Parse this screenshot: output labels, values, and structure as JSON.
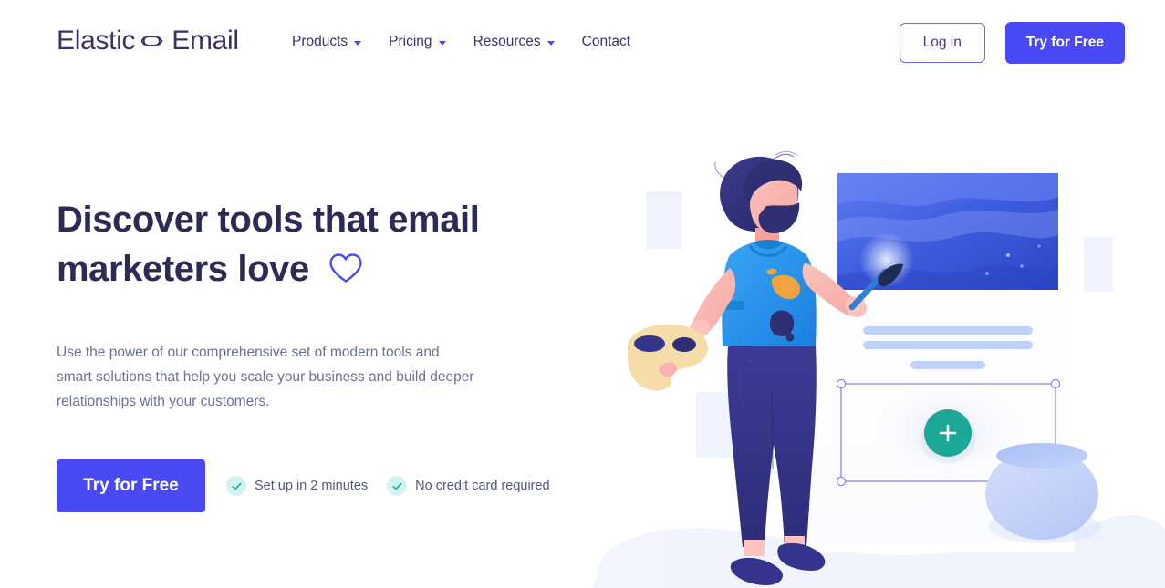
{
  "header": {
    "logo": {
      "word_left": "Elastic",
      "word_right": "Email",
      "mark": "link-loop-icon"
    },
    "nav": [
      {
        "label": "Products",
        "has_dropdown": true,
        "icon": "chevron-down-icon"
      },
      {
        "label": "Pricing",
        "has_dropdown": true,
        "icon": "chevron-down-icon"
      },
      {
        "label": "Resources",
        "has_dropdown": true,
        "icon": "chevron-down-icon"
      },
      {
        "label": "Contact",
        "has_dropdown": false,
        "icon": ""
      }
    ],
    "login_label": "Log in",
    "try_label": "Try for Free"
  },
  "hero": {
    "headline_line1": "Discover tools that email",
    "headline_line2": "marketers love",
    "headline_icon": "heart-outline-icon",
    "body": "Use the power of our comprehensive set of modern tools and smart solutions that help you scale your business and build deeper relationships with your customers.",
    "cta_label": "Try for Free",
    "features": [
      {
        "label": "Set up in 2 minutes",
        "icon": "check-circle-icon"
      },
      {
        "label": "No credit card required",
        "icon": "check-circle-icon"
      }
    ]
  },
  "illustration": {
    "name": "artist-painting-email-template-illustration",
    "parts": [
      "artist-character",
      "paint-palette",
      "paint-brush",
      "email-template-card",
      "ocean-photo-block",
      "text-placeholder-bars",
      "selection-rectangle",
      "add-block-button",
      "decorative-rectangles",
      "blue-sphere"
    ],
    "add_button_label": "+"
  },
  "colors": {
    "brand_blue": "#4a4af4",
    "nav_text": "#353566",
    "headline": "#2b2b55",
    "body_text": "#6a7191",
    "teal_accent": "#1ca897",
    "check_badge_bg": "#d6f2ee",
    "page_bg": "#ffffff",
    "pale_blue": "#eef3fd",
    "selection_purple": "#8b7ef0",
    "skin": "#f7b3b0",
    "hair_navy": "#2f2f73",
    "shirt_blue": "#2e9bf0",
    "jeans_navy": "#34348c",
    "palette_tan": "#f5dca8",
    "splat_orange": "#f0a33f"
  }
}
